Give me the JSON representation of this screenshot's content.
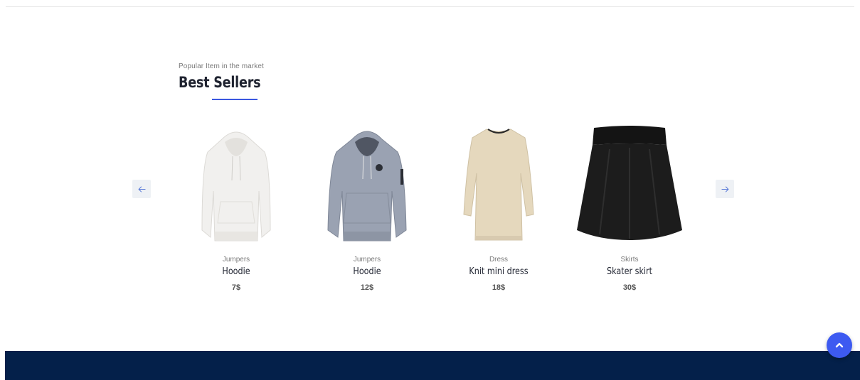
{
  "section": {
    "eyebrow": "Popular Item in the market",
    "title": "Best Sellers"
  },
  "carousel": {
    "prev_icon": "arrow-left-icon",
    "next_icon": "arrow-right-icon"
  },
  "products": [
    {
      "category": "Jumpers",
      "name": "Hoodie",
      "price": "7$",
      "image": "white-hoodie"
    },
    {
      "category": "Jumpers",
      "name": "Hoodie",
      "price": "12$",
      "image": "grey-hoodie"
    },
    {
      "category": "Dress",
      "name": "Knit mini dress",
      "price": "18$",
      "image": "beige-knit-dress"
    },
    {
      "category": "Skirts",
      "name": "Skater skirt",
      "price": "30$",
      "image": "black-skater-skirt"
    }
  ],
  "colors": {
    "accent": "#3b57e0",
    "footer": "#04204a",
    "back_to_top": "#3d5af1"
  },
  "back_to_top": {
    "icon": "chevron-up-icon"
  }
}
